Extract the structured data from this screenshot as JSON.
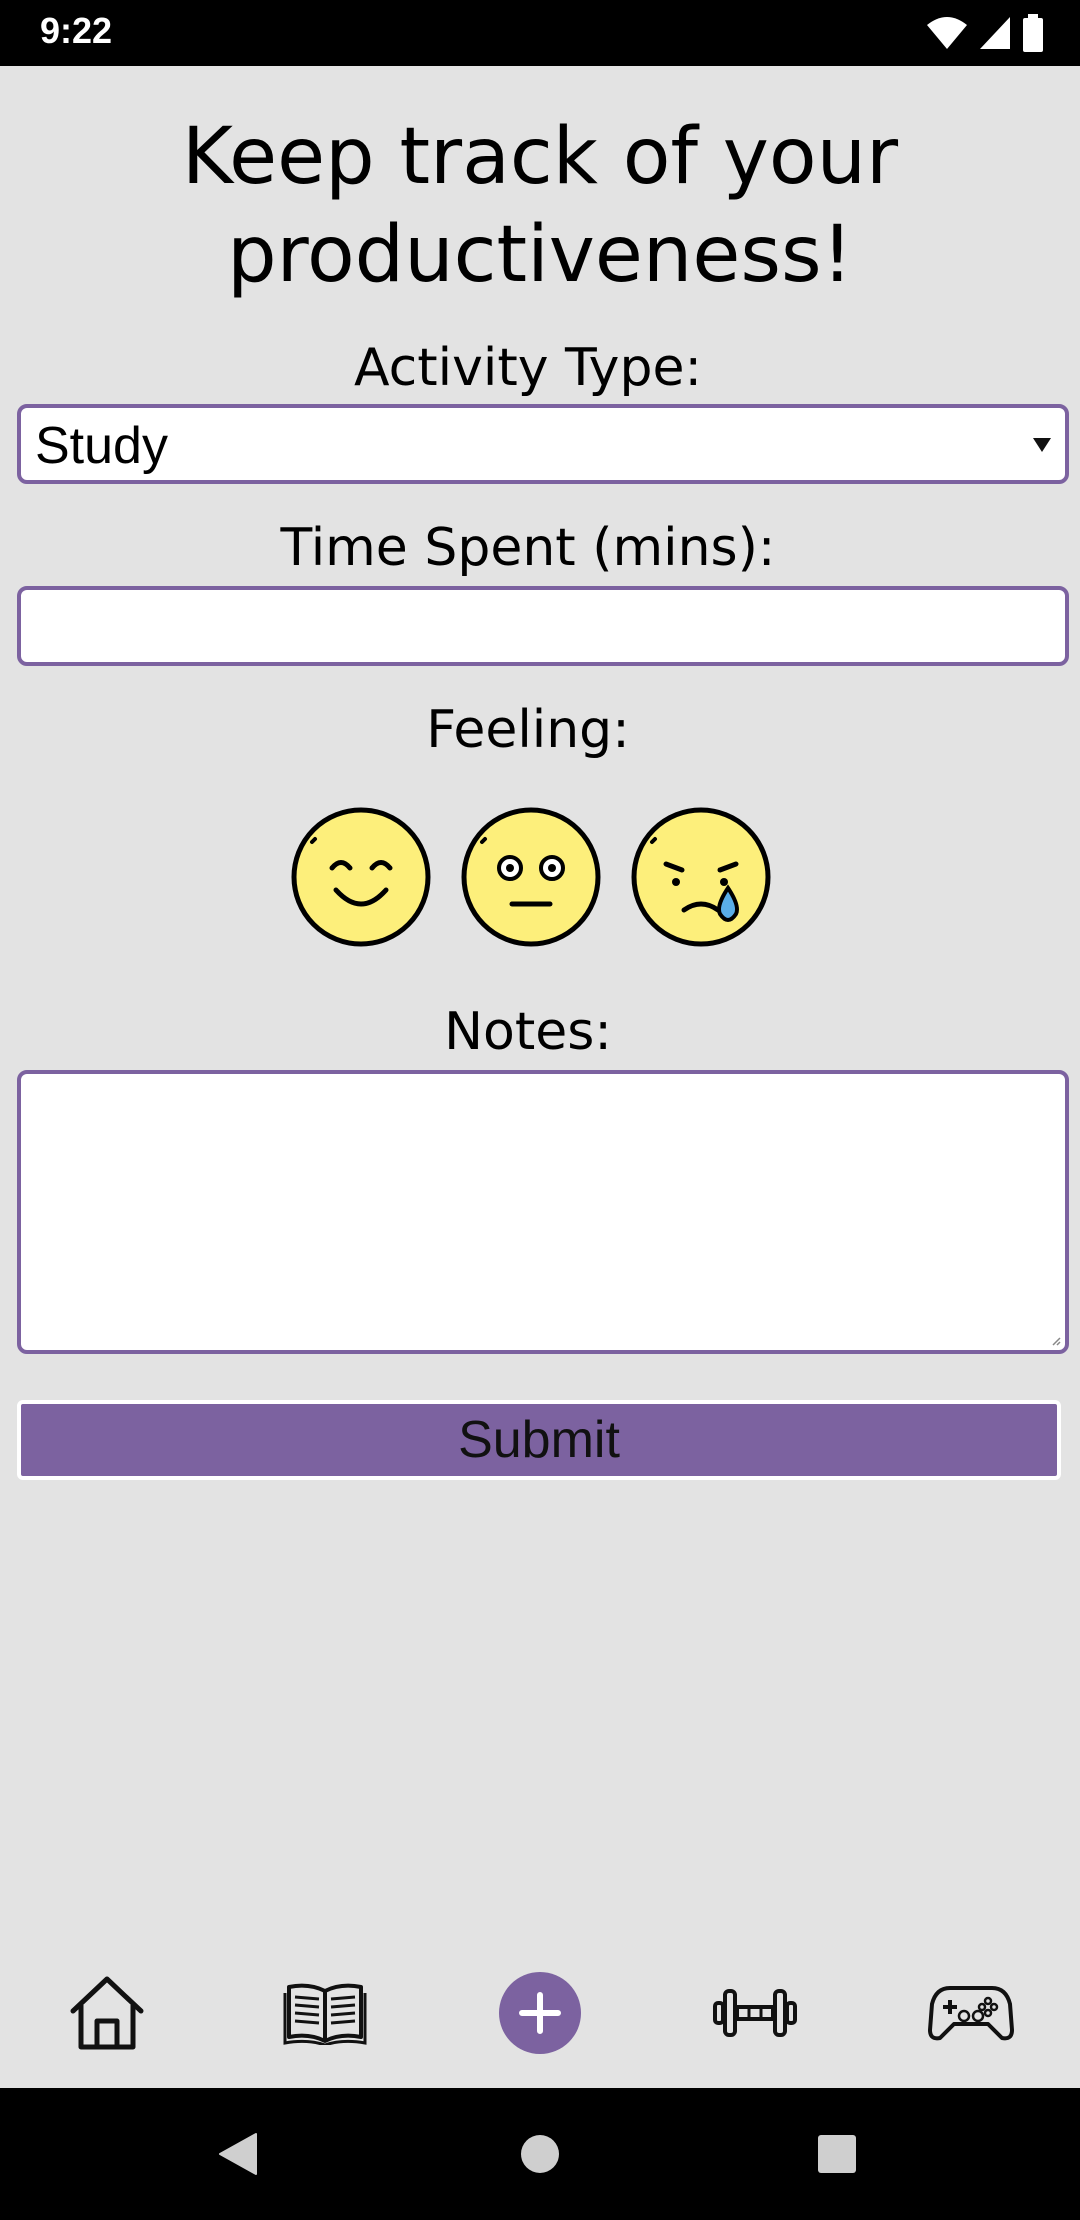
{
  "status_bar": {
    "time": "9:22",
    "icons": [
      "wifi-icon",
      "cell-signal-icon",
      "battery-icon"
    ]
  },
  "page": {
    "title": "Keep track of your productiveness!"
  },
  "form": {
    "activity_label": "Activity Type:",
    "activity_value": "Study",
    "time_label": "Time Spent (mins):",
    "time_value": "",
    "feeling_label": "Feeling:",
    "feelings": [
      "happy-face-icon",
      "neutral-face-icon",
      "sad-crying-face-icon"
    ],
    "notes_label": "Notes:",
    "notes_value": "",
    "submit_label": "Submit"
  },
  "bottom_nav": {
    "items": [
      "home-icon",
      "book-icon",
      "add-icon",
      "dumbbell-icon",
      "gamepad-icon"
    ]
  },
  "android_nav": {
    "items": [
      "back-icon",
      "home-circle-icon",
      "recents-icon"
    ]
  },
  "colors": {
    "accent": "#7c62a0",
    "background": "#e3e3e3",
    "face_fill": "#fdef7b",
    "tear": "#5aaee8"
  }
}
